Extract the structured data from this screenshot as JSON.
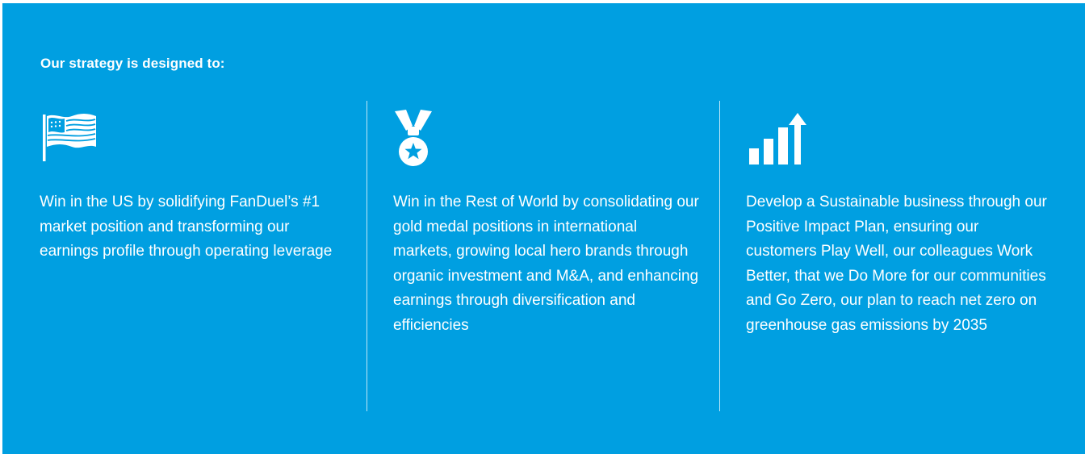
{
  "heading": "Our strategy is designed to:",
  "colors": {
    "background": "#009fe1",
    "foreground": "#ffffff"
  },
  "columns": [
    {
      "icon": "us-flag-icon",
      "text": "Win in the US by solidifying FanDuel’s #1 market position and transforming our earnings profile through operating leverage"
    },
    {
      "icon": "medal-icon",
      "text": "Win in the Rest of World by consolidating our gold medal positions in international markets, growing local hero brands through organic investment and M&A, and enhancing earnings through diversification and efficiencies"
    },
    {
      "icon": "growth-chart-icon",
      "text": "Develop a Sustainable business through our Positive Impact Plan, ensuring our customers Play Well, our colleagues Work Better, that we Do More for our communities and Go Zero, our plan to reach net zero on greenhouse gas emissions by 2035"
    }
  ]
}
